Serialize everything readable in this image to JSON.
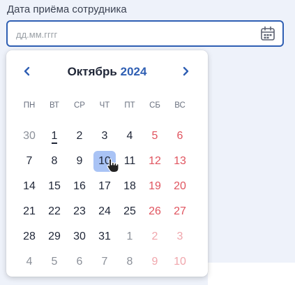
{
  "field": {
    "label": "Дата приёма сотрудника",
    "placeholder": "дд.мм.гггг",
    "value": ""
  },
  "calendar": {
    "month": "Октябрь",
    "year": "2024",
    "weekdays": [
      "ПН",
      "ВТ",
      "СР",
      "ЧТ",
      "ПТ",
      "СБ",
      "ВС"
    ],
    "weeks": [
      [
        {
          "d": "30",
          "other": true
        },
        {
          "d": "1",
          "today": true
        },
        {
          "d": "2"
        },
        {
          "d": "3"
        },
        {
          "d": "4"
        },
        {
          "d": "5"
        },
        {
          "d": "6"
        }
      ],
      [
        {
          "d": "7"
        },
        {
          "d": "8"
        },
        {
          "d": "9"
        },
        {
          "d": "10",
          "hovered": true
        },
        {
          "d": "11"
        },
        {
          "d": "12"
        },
        {
          "d": "13"
        }
      ],
      [
        {
          "d": "14"
        },
        {
          "d": "15"
        },
        {
          "d": "16"
        },
        {
          "d": "17"
        },
        {
          "d": "18"
        },
        {
          "d": "19"
        },
        {
          "d": "20"
        }
      ],
      [
        {
          "d": "21"
        },
        {
          "d": "22"
        },
        {
          "d": "23"
        },
        {
          "d": "24"
        },
        {
          "d": "25"
        },
        {
          "d": "26"
        },
        {
          "d": "27"
        }
      ],
      [
        {
          "d": "28"
        },
        {
          "d": "29"
        },
        {
          "d": "30"
        },
        {
          "d": "31"
        },
        {
          "d": "1",
          "other": true
        },
        {
          "d": "2",
          "other": true
        },
        {
          "d": "3",
          "other": true
        }
      ],
      [
        {
          "d": "4",
          "other": true
        },
        {
          "d": "5",
          "other": true
        },
        {
          "d": "6",
          "other": true
        },
        {
          "d": "7",
          "other": true
        },
        {
          "d": "8",
          "other": true
        },
        {
          "d": "9",
          "other": true
        },
        {
          "d": "10",
          "other": true
        }
      ]
    ]
  },
  "icons": {
    "calendar": "calendar-icon",
    "prev": "chevron-left-icon",
    "next": "chevron-right-icon",
    "cursor": "hand-pointer-cursor"
  },
  "colors": {
    "accent": "#2f5fb3",
    "weekend": "#e0545f",
    "hover": "#a9c3f5"
  }
}
